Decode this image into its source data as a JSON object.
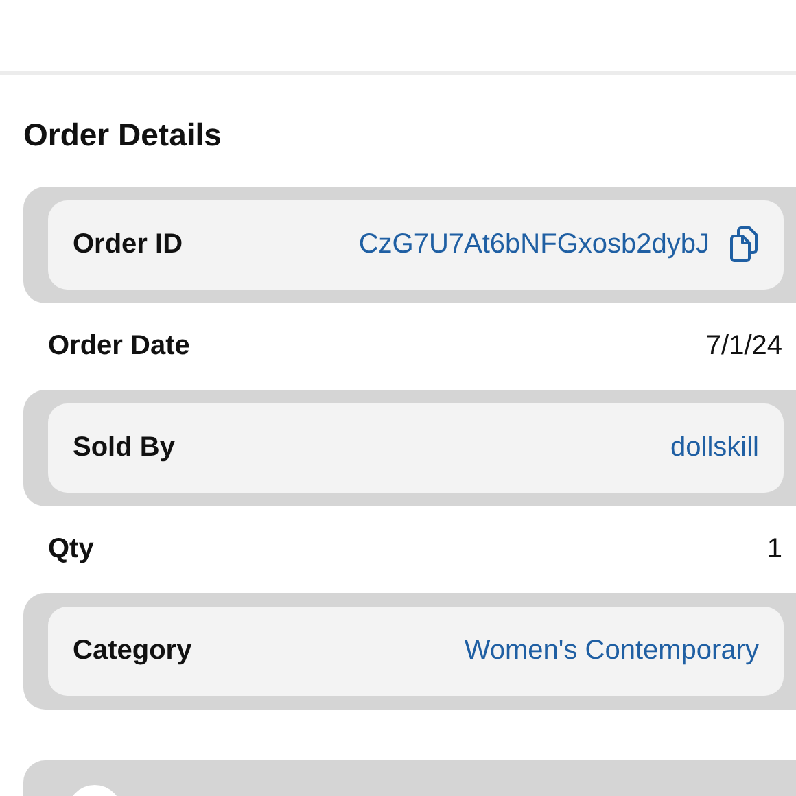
{
  "section_title": "Order Details",
  "rows": [
    {
      "kind": "card",
      "label": "Order ID",
      "value": "CzG7U7At6bNFGxosb2dybJ",
      "link": true,
      "copyable": true
    },
    {
      "kind": "plain",
      "label": "Order Date",
      "value": "7/1/24",
      "link": false,
      "copyable": false
    },
    {
      "kind": "card",
      "label": "Sold By",
      "value": "dollskill",
      "link": true,
      "copyable": false
    },
    {
      "kind": "plain",
      "label": "Qty",
      "value": "1",
      "link": false,
      "copyable": false
    },
    {
      "kind": "card",
      "label": "Category",
      "value": "Women's Contemporary",
      "link": true,
      "copyable": false
    }
  ]
}
